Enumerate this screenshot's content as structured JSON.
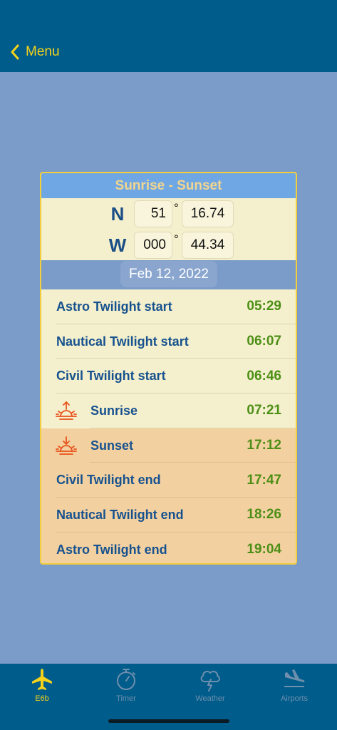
{
  "nav": {
    "back_label": "Menu"
  },
  "card": {
    "title": "Sunrise - Sunset",
    "lat": {
      "hemisphere": "N",
      "degrees": "51",
      "deg_symbol": "°",
      "minutes": "16.74"
    },
    "lon": {
      "hemisphere": "W",
      "degrees": "000",
      "deg_symbol": "°",
      "minutes": "44.34"
    },
    "date": "Feb 12, 2022"
  },
  "events": [
    {
      "label": "Astro Twilight start",
      "time": "05:29"
    },
    {
      "label": "Nautical Twilight start",
      "time": "06:07"
    },
    {
      "label": "Civil Twilight start",
      "time": "06:46"
    },
    {
      "label": "Sunrise",
      "time": "07:21",
      "icon": "sunrise-icon"
    },
    {
      "label": "Sunset",
      "time": "17:12",
      "icon": "sunset-icon"
    },
    {
      "label": "Civil Twilight end",
      "time": "17:47"
    },
    {
      "label": "Nautical Twilight end",
      "time": "18:26"
    },
    {
      "label": "Astro Twilight end",
      "time": "19:04"
    }
  ],
  "tabs": [
    {
      "label": "E6b",
      "icon": "airplane-icon",
      "active": true
    },
    {
      "label": "Timer",
      "icon": "stopwatch-icon",
      "active": false
    },
    {
      "label": "Weather",
      "icon": "storm-cloud-icon",
      "active": false
    },
    {
      "label": "Airports",
      "icon": "airplane-landing-icon",
      "active": false
    }
  ],
  "colors": {
    "nav_bg": "#005c8a",
    "accent_yellow": "#f5d21b",
    "page_bg": "#7b9bc9",
    "label_blue": "#17528f",
    "time_green": "#4d8f16",
    "sun_icon_orange": "#e8521c"
  }
}
